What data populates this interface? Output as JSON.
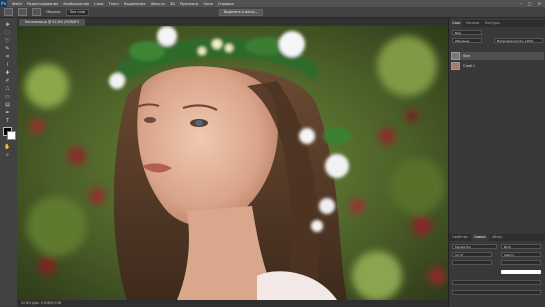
{
  "app": {
    "logo": "Ps"
  },
  "menu": [
    "Файл",
    "Редактирование",
    "Изображение",
    "Слои",
    "Текст",
    "Выделение",
    "Фильтр",
    "3D",
    "Просмотр",
    "Окно",
    "Справка"
  ],
  "window_controls": [
    "–",
    "□",
    "✕"
  ],
  "options_bar": {
    "sample_label": "Образец:",
    "sample_value": "Все слои",
    "refine_button": "Выделить и маску..."
  },
  "document": {
    "tab_title": "Капельница @ 52,8% (RGB/8*)",
    "zoom": "52,8%",
    "status": "52,8%  Док: 5,93M/5,93M"
  },
  "colors": {
    "foreground": "#000000",
    "background": "#ffffff"
  },
  "panels": {
    "top_tabs": [
      "Слои",
      "Каналы",
      "Контуры"
    ],
    "layer_kind_label": "Вид",
    "blend_mode": "Обычные",
    "opacity_label": "Непрозрачность: 100%",
    "layers": [
      "Фон",
      "Слой 1"
    ],
    "bottom_tabs": [
      "Свойства",
      "Символ",
      "Абзац"
    ],
    "font_family": "Myriad Pro",
    "font_style": "Bold",
    "font_size": "12 пт",
    "leading": "(Авто)"
  }
}
